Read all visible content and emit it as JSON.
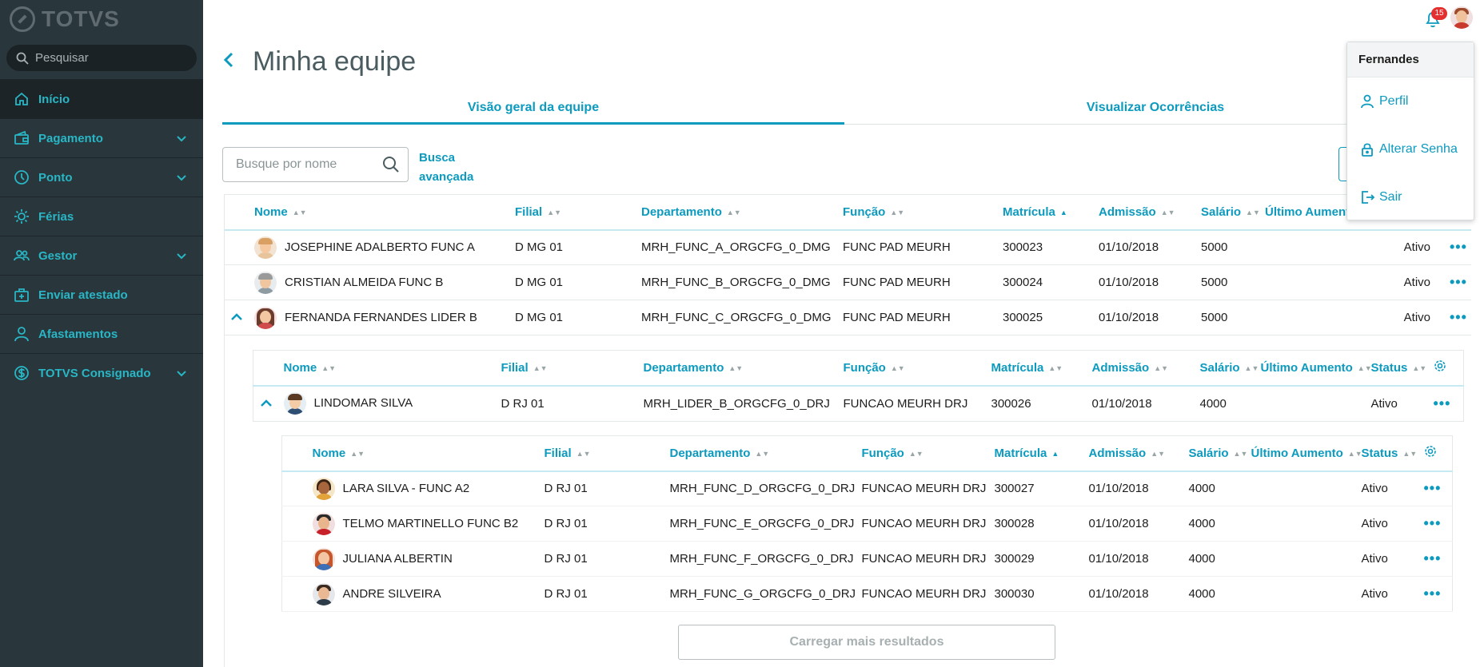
{
  "app": {
    "logo": "TOTVS",
    "search_placeholder": "Pesquisar"
  },
  "nav": [
    {
      "label": "Início",
      "icon": "home-icon",
      "active": true,
      "expandable": false
    },
    {
      "label": "Pagamento",
      "icon": "wallet-icon",
      "expandable": true
    },
    {
      "label": "Ponto",
      "icon": "clock-icon",
      "expandable": true
    },
    {
      "label": "Férias",
      "icon": "sun-icon",
      "expandable": false
    },
    {
      "label": "Gestor",
      "icon": "users-icon",
      "expandable": true
    },
    {
      "label": "Enviar atestado",
      "icon": "medical-case-icon",
      "expandable": false
    },
    {
      "label": "Afastamentos",
      "icon": "person-icon",
      "expandable": false
    },
    {
      "label": "TOTVS Consignado",
      "icon": "dollar-icon",
      "expandable": true
    }
  ],
  "header": {
    "notifications": "15"
  },
  "user_menu": {
    "name": "Fernandes",
    "items": [
      "Perfil",
      "Alterar Senha",
      "Sair"
    ]
  },
  "page": {
    "title": "Minha equipe",
    "tabs": [
      "Visão geral da equipe",
      "Visualizar Ocorrências"
    ],
    "search_placeholder": "Busque por nome",
    "advanced_search": [
      "Busca",
      "avançada"
    ],
    "load_more": "Carregar mais resultados"
  },
  "table": {
    "columns": [
      "Nome",
      "Filial",
      "Departamento",
      "Função",
      "Matrícula",
      "Admissão",
      "Salário",
      "Último Aumento",
      "Status"
    ],
    "rows": [
      {
        "nome": "JOSEPHINE ADALBERTO FUNC A",
        "filial": "D MG 01",
        "departamento": "MRH_FUNC_A_ORGCFG_0_DMG",
        "funcao": "FUNC PAD MEURH",
        "matricula": "300023",
        "admissao": "01/10/2018",
        "salario": "5000",
        "status": "Ativo"
      },
      {
        "nome": "CRISTIAN ALMEIDA FUNC B",
        "filial": "D MG 01",
        "departamento": "MRH_FUNC_B_ORGCFG_0_DMG",
        "funcao": "FUNC PAD MEURH",
        "matricula": "300024",
        "admissao": "01/10/2018",
        "salario": "5000",
        "status": "Ativo"
      },
      {
        "nome": "FERNANDA FERNANDES LIDER B",
        "filial": "D MG 01",
        "departamento": "MRH_FUNC_C_ORGCFG_0_DMG",
        "funcao": "FUNC PAD MEURH",
        "matricula": "300025",
        "admissao": "01/10/2018",
        "salario": "5000",
        "status": "Ativo"
      }
    ],
    "sub1": {
      "nome": "LINDOMAR SILVA",
      "filial": "D RJ 01",
      "departamento": "MRH_LIDER_B_ORGCFG_0_DRJ",
      "funcao": "FUNCAO MEURH DRJ",
      "matricula": "300026",
      "admissao": "01/10/2018",
      "salario": "4000",
      "status": "Ativo"
    },
    "sub2": [
      {
        "nome": "LARA SILVA - FUNC A2",
        "filial": "D RJ 01",
        "departamento": "MRH_FUNC_D_ORGCFG_0_DRJ",
        "funcao": "FUNCAO MEURH DRJ",
        "matricula": "300027",
        "admissao": "01/10/2018",
        "salario": "4000",
        "status": "Ativo"
      },
      {
        "nome": "TELMO MARTINELLO FUNC B2",
        "filial": "D RJ 01",
        "departamento": "MRH_FUNC_E_ORGCFG_0_DRJ",
        "funcao": "FUNCAO MEURH DRJ",
        "matricula": "300028",
        "admissao": "01/10/2018",
        "salario": "4000",
        "status": "Ativo"
      },
      {
        "nome": "JULIANA ALBERTIN",
        "filial": "D RJ 01",
        "departamento": "MRH_FUNC_F_ORGCFG_0_DRJ",
        "funcao": "FUNCAO MEURH DRJ",
        "matricula": "300029",
        "admissao": "01/10/2018",
        "salario": "4000",
        "status": "Ativo"
      },
      {
        "nome": "ANDRE SILVEIRA",
        "filial": "D RJ 01",
        "departamento": "MRH_FUNC_G_ORGCFG_0_DRJ",
        "funcao": "FUNCAO MEURH DRJ",
        "matricula": "300030",
        "admissao": "01/10/2018",
        "salario": "4000",
        "status": "Ativo"
      }
    ]
  },
  "colors": {
    "accent": "#0c9abe",
    "sidebar": "#29363c",
    "sidebar_text": "#29b6c5",
    "badge": "#e32f2f"
  }
}
